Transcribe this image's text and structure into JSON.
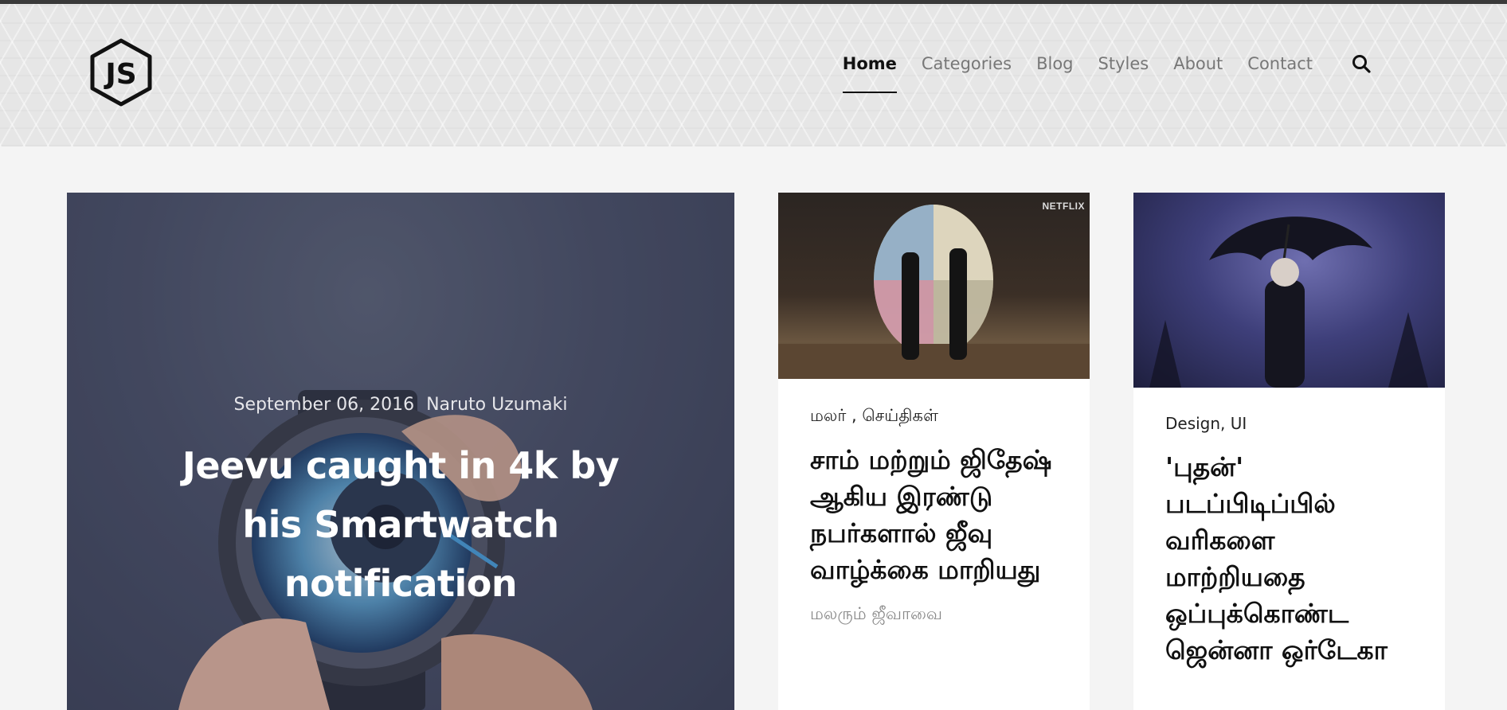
{
  "header": {
    "logo_text": "JS",
    "nav": [
      {
        "label": "Home",
        "active": true
      },
      {
        "label": "Categories",
        "active": false
      },
      {
        "label": "Blog",
        "active": false
      },
      {
        "label": "Styles",
        "active": false
      },
      {
        "label": "About",
        "active": false
      },
      {
        "label": "Contact",
        "active": false
      }
    ],
    "search_icon": "search-icon"
  },
  "hero": {
    "date": "September 06, 2016",
    "author": "Naruto Uzumaki",
    "title": "Jeevu caught in 4k by his Smartwatch notification"
  },
  "cards": [
    {
      "badge": "NETFLIX",
      "categories": "மலர் , செய்திகள்",
      "title": "சாம் மற்றும் ஜிதேஷ் ஆகிய இரண்டு நபர்களால் ஜீவு வாழ்க்கை மாறியது",
      "excerpt": "மலரும் ஜீவாவை"
    },
    {
      "categories": "Design, UI",
      "title": "'புதன்' படப்பிடிப்பில் வரிகளை மாற்றியதை ஒப்புக்கொண்ட ஜென்னா ஒர்டேகா"
    }
  ],
  "colors": {
    "background": "#f4f4f4",
    "header_bg": "#e6e6e6",
    "hero_bg": "#4b5169",
    "nav_active": "#111111",
    "nav_inactive": "#777777"
  }
}
